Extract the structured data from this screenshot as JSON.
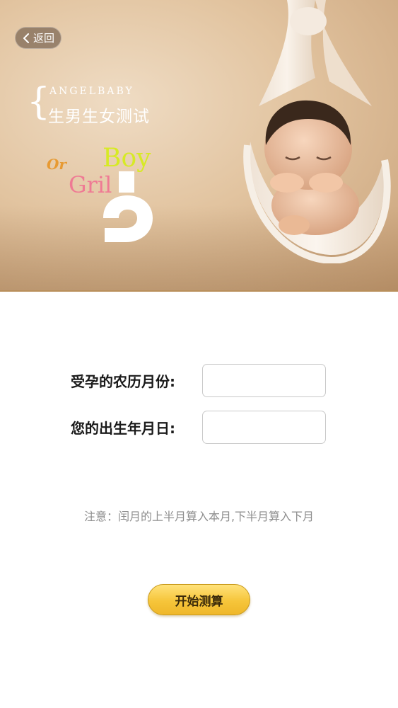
{
  "header": {
    "back_label": "返回"
  },
  "banner": {
    "brand": "ANGELBABY",
    "title": "生男生女测试",
    "or_text": "Or",
    "boy_text": "Boy",
    "gril_text": "Gril"
  },
  "form": {
    "conception_month_label": "受孕的农历月份:",
    "conception_month_value": "",
    "birth_date_label": "您的出生年月日:",
    "birth_date_value": ""
  },
  "note": "注意：闰月的上半月算入本月,下半月算入下月",
  "actions": {
    "start_label": "开始测算"
  },
  "colors": {
    "accent": "#f6c53a",
    "boy": "#d7ea25",
    "gril": "#ef7a94",
    "or": "#e79a33"
  }
}
